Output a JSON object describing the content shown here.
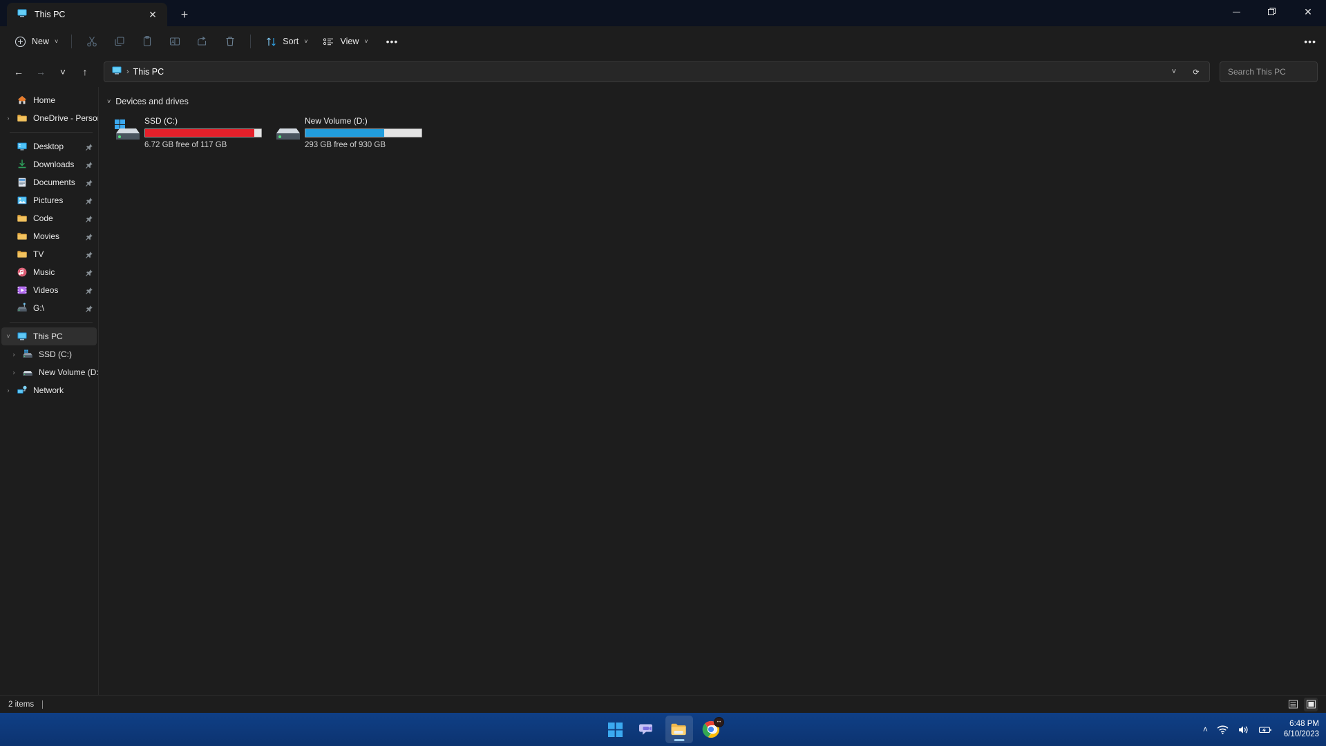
{
  "window": {
    "tab": {
      "title": "This PC",
      "icon": "this-pc-icon",
      "close_label": "✕"
    },
    "new_tab_label": "+",
    "controls": {
      "minimize": "─",
      "restore": "❐",
      "close": "✕"
    }
  },
  "toolbar": {
    "new_label": "New",
    "sort_label": "Sort",
    "view_label": "View",
    "overflow_label": "•••",
    "see_more_label": "•••",
    "chevron": "˅",
    "items": [
      {
        "name": "cut-icon",
        "label": "Cut"
      },
      {
        "name": "copy-icon",
        "label": "Copy"
      },
      {
        "name": "paste-icon",
        "label": "Paste"
      },
      {
        "name": "rename-icon",
        "label": "Rename"
      },
      {
        "name": "share-icon",
        "label": "Share"
      },
      {
        "name": "delete-icon",
        "label": "Delete"
      }
    ]
  },
  "address": {
    "back": "←",
    "forward": "→",
    "recent": "˅",
    "up": "↑",
    "breadcrumb_icon": "this-pc-icon",
    "breadcrumb_sep": "›",
    "breadcrumb_text": "This PC",
    "dropdown": "˅",
    "refresh": "⟳"
  },
  "search": {
    "placeholder": "Search This PC",
    "value": "",
    "icon": "search-icon"
  },
  "sidebar": {
    "items": [
      {
        "label": "Home",
        "icon": "home-icon",
        "expander": "",
        "pinned": false,
        "selected": false,
        "indent": 0
      },
      {
        "label": "OneDrive - Personal",
        "icon": "folder-icon",
        "expander": "›",
        "pinned": false,
        "selected": false,
        "indent": 0
      },
      {
        "label": "Desktop",
        "icon": "desktop-icon",
        "expander": "",
        "pinned": true,
        "selected": false,
        "indent": 0
      },
      {
        "label": "Downloads",
        "icon": "downloads-icon",
        "expander": "",
        "pinned": true,
        "selected": false,
        "indent": 0
      },
      {
        "label": "Documents",
        "icon": "documents-icon",
        "expander": "",
        "pinned": true,
        "selected": false,
        "indent": 0
      },
      {
        "label": "Pictures",
        "icon": "pictures-icon",
        "expander": "",
        "pinned": true,
        "selected": false,
        "indent": 0
      },
      {
        "label": "Code",
        "icon": "folder-icon",
        "expander": "",
        "pinned": true,
        "selected": false,
        "indent": 0
      },
      {
        "label": "Movies",
        "icon": "folder-icon",
        "expander": "",
        "pinned": true,
        "selected": false,
        "indent": 0
      },
      {
        "label": "TV",
        "icon": "folder-icon",
        "expander": "",
        "pinned": true,
        "selected": false,
        "indent": 0
      },
      {
        "label": "Music",
        "icon": "music-icon",
        "expander": "",
        "pinned": true,
        "selected": false,
        "indent": 0
      },
      {
        "label": "Videos",
        "icon": "videos-icon",
        "expander": "",
        "pinned": true,
        "selected": false,
        "indent": 0
      },
      {
        "label": "G:\\",
        "icon": "network-drive-icon",
        "expander": "",
        "pinned": true,
        "selected": false,
        "indent": 0
      },
      {
        "label": "This PC",
        "icon": "this-pc-icon",
        "expander": "˅",
        "pinned": false,
        "selected": true,
        "indent": 0
      },
      {
        "label": "SSD (C:)",
        "icon": "system-drive-icon",
        "expander": "›",
        "pinned": false,
        "selected": false,
        "indent": 1
      },
      {
        "label": "New Volume (D:)",
        "icon": "drive-icon",
        "expander": "›",
        "pinned": false,
        "selected": false,
        "indent": 1
      },
      {
        "label": "Network",
        "icon": "network-icon",
        "expander": "›",
        "pinned": false,
        "selected": false,
        "indent": 0
      }
    ]
  },
  "content": {
    "group_title": "Devices and drives",
    "group_chevron": "˅",
    "drives": [
      {
        "name": "SSD (C:)",
        "icon": "system-drive-icon",
        "capacity_text": "6.72 GB free of 117 GB",
        "used_percent": 94,
        "bar_color": "#e5202a",
        "free": "6.72 GB",
        "total": "117 GB"
      },
      {
        "name": "New Volume (D:)",
        "icon": "drive-icon",
        "capacity_text": "293 GB free of 930 GB",
        "used_percent": 68,
        "bar_color": "#219ddd",
        "free": "293 GB",
        "total": "930 GB"
      }
    ]
  },
  "statusbar": {
    "item_count": "2 items",
    "details_view": "details-view-icon",
    "large_icons_view": "large-icons-view-icon"
  },
  "taskbar": {
    "apps": [
      {
        "name": "start-button",
        "label": "Start",
        "active": false,
        "badge": false
      },
      {
        "name": "teams-icon",
        "label": "Microsoft Teams",
        "active": false,
        "badge": false
      },
      {
        "name": "file-explorer-icon",
        "label": "File Explorer",
        "active": true,
        "badge": false
      },
      {
        "name": "chrome-icon",
        "label": "Google Chrome",
        "active": false,
        "badge": true
      }
    ],
    "tray": {
      "overflow": "˄",
      "wifi": "wifi-icon",
      "volume": "volume-icon",
      "battery": "battery-charging-icon",
      "time": "6:48 PM",
      "date": "6/10/2023"
    }
  },
  "colors": {
    "accent": "#219ddd",
    "danger": "#e5202a",
    "window_bg": "#1d1d1d",
    "titlebar_bg": "#0c1220",
    "taskbar_bg": "#0e3a7c"
  }
}
